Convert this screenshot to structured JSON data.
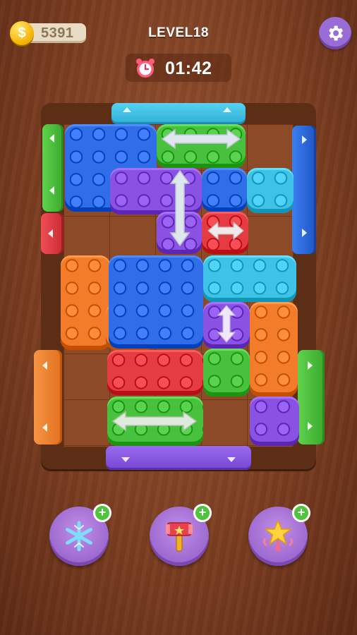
{
  "hud": {
    "coins": "5391",
    "level": "LEVEL18",
    "timer": "01:42",
    "coin_symbol": "$"
  },
  "colors": {
    "background": "#7d3f22",
    "blue": "#2f6ee8",
    "green": "#48c23e",
    "purple": "#8a52e3",
    "cyan": "#3ec3e6",
    "red": "#e53b42",
    "orange": "#f27c2a",
    "rail_purple": "#8b5ae3",
    "rail_blue": "#2f6ee8",
    "rail_cyan": "#3ec3e6"
  },
  "board": {
    "rows": 7,
    "cols": 6,
    "bricks": [
      {
        "id": "blue-top-left",
        "color": "blue",
        "arrow": "none"
      },
      {
        "id": "green-top-h",
        "color": "green",
        "arrow": "horizontal"
      },
      {
        "id": "purple-l-v",
        "color": "purple",
        "arrow": "vertical"
      },
      {
        "id": "blue-mid",
        "color": "blue",
        "arrow": "none"
      },
      {
        "id": "cyan-small",
        "color": "cyan",
        "arrow": "none"
      },
      {
        "id": "red-small-h",
        "color": "red",
        "arrow": "horizontal"
      },
      {
        "id": "orange-l",
        "color": "orange",
        "arrow": "none"
      },
      {
        "id": "blue-center",
        "color": "blue",
        "arrow": "none"
      },
      {
        "id": "cyan-wide",
        "color": "cyan",
        "arrow": "none"
      },
      {
        "id": "purple-small-v",
        "color": "purple",
        "arrow": "vertical"
      },
      {
        "id": "orange-v",
        "color": "orange",
        "arrow": "none"
      },
      {
        "id": "red-wide",
        "color": "red",
        "arrow": "none"
      },
      {
        "id": "green-small",
        "color": "green",
        "arrow": "none"
      },
      {
        "id": "green-bottom-h",
        "color": "green",
        "arrow": "horizontal"
      },
      {
        "id": "purple-bottom-right",
        "color": "purple",
        "arrow": "none"
      }
    ],
    "rails": [
      {
        "id": "rail-top",
        "color": "cyan",
        "side": "top"
      },
      {
        "id": "rail-left-top",
        "color": "green",
        "side": "left"
      },
      {
        "id": "rail-left-mid",
        "color": "red",
        "side": "left"
      },
      {
        "id": "rail-left-bottom",
        "color": "orange",
        "side": "left"
      },
      {
        "id": "rail-right-top",
        "color": "blue",
        "side": "right"
      },
      {
        "id": "rail-right-bottom",
        "color": "green",
        "side": "right"
      },
      {
        "id": "rail-bottom",
        "color": "purple",
        "side": "bottom"
      }
    ]
  },
  "boosters": [
    {
      "name": "freeze",
      "icon": "snowflake-icon"
    },
    {
      "name": "hammer",
      "icon": "hammer-icon"
    },
    {
      "name": "magic-wand",
      "icon": "star-wand-icon"
    }
  ],
  "booster_plus": "+"
}
